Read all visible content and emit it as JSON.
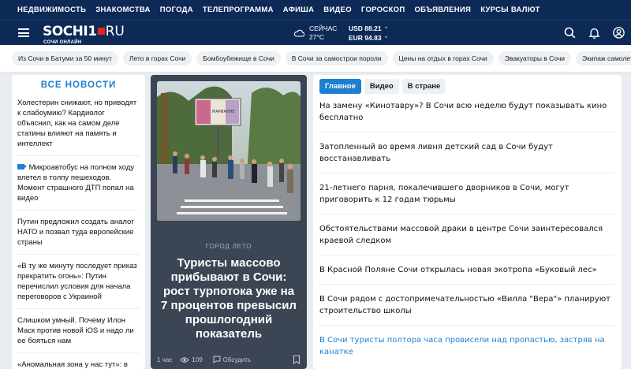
{
  "topnav": [
    "НЕДВИЖИМОСТЬ",
    "ЗНАКОМСТВА",
    "ПОГОДА",
    "ТЕЛЕПРОГРАММА",
    "АФИША",
    "ВИДЕО",
    "ГОРОСКОП",
    "ОБЪЯВЛЕНИЯ",
    "КУРСЫ ВАЛЮТ"
  ],
  "logo": {
    "name": "SOCHI1",
    "tld": "RU",
    "subtitle": "СОЧИ ОНЛАЙН"
  },
  "weather": {
    "label": "СЕЙЧАС",
    "temp": "27°C"
  },
  "rates": {
    "usd": "USD 88.21",
    "eur": "EUR 94.83"
  },
  "tags": [
    "Из Сочи в Батуми за 50 минут",
    "Лето в горах Сочи",
    "Бомбоубежище в Сочи",
    "В Сочи за самострои пороли",
    "Цены на отдых в горах Сочи",
    "Эвакуаторы в Сочи",
    "Экипаж самолета по"
  ],
  "left": {
    "title": "ВСЕ НОВОСТИ",
    "items": [
      "Холестерин снижают, но приводят к слабоумию? Кардиолог объяснил, как на самом деле статины влияют на память и интеллект",
      "Микроавтобус на полном ходу влетел в толпу пешеходов. Момент страшного ДТП попал на видео",
      "Путин предложил создать аналог НАТО и позвал туда европейские страны",
      "«В ту же минуту последует приказ прекратить огонь»: Путин перечислил условия для начала переговоров с Украиной",
      "Слишком умный. Почему Илон Маск против новой iOS и надо ли ее бояться нам",
      "«Аномальная зона у нас тут»: в сибирское село приехали"
    ]
  },
  "featured": {
    "categories": "ГОРОД  ЛЕТО",
    "title": "Туристы массово прибывают в Сочи: рост турпотока уже на 7 процентов превысил прошлогодний показатель",
    "time": "1 час",
    "views": "109",
    "discuss": "Обсудить",
    "billboard": "МАРИАННЕ"
  },
  "right": {
    "tabs": [
      "Главное",
      "Видео",
      "В стране"
    ],
    "news": [
      "На замену «Кинотавру»? В Сочи всю неделю будут показывать кино бесплатно",
      "Затопленный во время ливня детский сад в Сочи будут восстанавливать",
      "21-летнего парня, покалечившего дворников в Сочи, могут приговорить к 12 годам тюрьмы",
      "Обстоятельствами массовой драки в центре Сочи заинтересовался краевой следком",
      "В Красной Поляне Сочи открылась новая экотропа «Буковый лес»",
      "В Сочи рядом с достопримечательностью «Вилла \"Вера\"» планируют строительство школы",
      "В Сочи туристы полтора часа провисели над пропастью, застряв на канатке"
    ]
  },
  "colors": {
    "nav_bg": "#0d2a57",
    "accent": "#1d7fd1",
    "logo_red": "#e52421",
    "featured_bg": "#3b4553"
  }
}
